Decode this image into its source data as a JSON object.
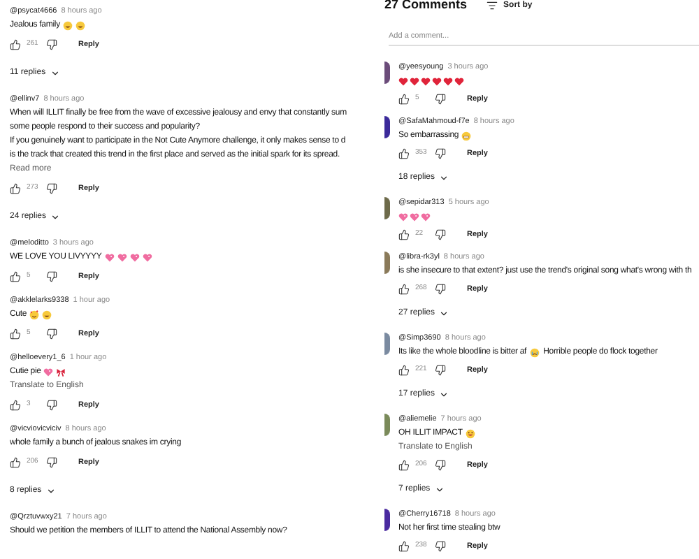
{
  "left_panel": {
    "items": [
      {
        "kind": "comment",
        "author": "@psycat4666",
        "time": "8 hours ago",
        "lines": [
          "Jealous family"
        ],
        "emojis": [
          {
            "kind": "laughing"
          },
          {
            "kind": "laughing"
          }
        ],
        "likes": "261",
        "reply": "Reply"
      },
      {
        "kind": "replies",
        "label": "11 replies"
      },
      {
        "kind": "comment",
        "author": "@ellinv7",
        "time": "8 hours ago",
        "lines": [
          "When will ILLIT finally be free from the wave of excessive jealousy and envy that constantly sum",
          "some people respond to their success and popularity?",
          "If you genuinely want to participate in the Not Cute Anymore challenge, it only makes sense to d",
          "is the track that created this trend in the first place and served as the initial spark for its spread."
        ],
        "read_more": "Read more",
        "likes": "273",
        "reply": "Reply"
      },
      {
        "kind": "replies",
        "label": "24 replies"
      },
      {
        "kind": "comment",
        "author": "@meloditto",
        "time": "3 hours ago",
        "lines": [
          "WE LOVE YOU LIVYYYY"
        ],
        "emojis": [
          {
            "kind": "pink-heart"
          },
          {
            "kind": "pink-heart"
          },
          {
            "kind": "pink-heart"
          },
          {
            "kind": "pink-heart"
          }
        ],
        "likes": "5",
        "reply": "Reply"
      },
      {
        "kind": "comment",
        "author": "@akklelarks9338",
        "time": "1 hour ago",
        "lines": [
          "Cute"
        ],
        "emojis": [
          {
            "kind": "heart-face"
          },
          {
            "kind": "laughing"
          }
        ],
        "likes": "5",
        "reply": "Reply"
      },
      {
        "kind": "comment",
        "author": "@helloevery1_6",
        "time": "1 hour ago",
        "lines": [
          "Cutie pie"
        ],
        "emojis": [
          {
            "kind": "pink-heart"
          },
          {
            "kind": "ribbon"
          }
        ],
        "translate": "Translate to English",
        "likes": "3",
        "reply": "Reply"
      },
      {
        "kind": "comment",
        "author": "@vicviovicviciv",
        "time": "8 hours ago",
        "lines": [
          "whole family a bunch of jealous snakes im crying"
        ],
        "likes": "206",
        "reply": "Reply"
      },
      {
        "kind": "replies",
        "label": "8 replies"
      },
      {
        "kind": "comment",
        "author": "@Qrztuvwxy21",
        "time": "7 hours ago",
        "lines": [
          "Should we petition the members of ILLIT to attend the National Assembly now?"
        ]
      }
    ]
  },
  "right_panel": {
    "title": "27 Comments",
    "sort": "Sort by",
    "add_comment": {
      "placeholder": "Add a comment..."
    },
    "items": [
      {
        "kind": "comment",
        "color": "#6b4c7a",
        "author": "@yeesyoung",
        "time": "3 hours ago",
        "emojis": [
          {
            "kind": "heart"
          },
          {
            "kind": "heart"
          },
          {
            "kind": "heart"
          },
          {
            "kind": "heart"
          },
          {
            "kind": "heart"
          },
          {
            "kind": "heart"
          }
        ],
        "likes": "5",
        "reply": "Reply"
      },
      {
        "kind": "comment",
        "color": "#3b2a9a",
        "author": "@SafaMahmoud-f7e",
        "time": "8 hours ago",
        "lines": [
          "So embarrassing"
        ],
        "emojis": [
          {
            "kind": "grimace"
          }
        ],
        "likes": "353",
        "reply": "Reply"
      },
      {
        "kind": "replies",
        "label": "18 replies"
      },
      {
        "kind": "comment",
        "color": "#6d6a4a",
        "author": "@sepidar313",
        "time": "5 hours ago",
        "emojis": [
          {
            "kind": "pink-heart"
          },
          {
            "kind": "pink-heart"
          },
          {
            "kind": "pink-heart"
          }
        ],
        "likes": "22",
        "reply": "Reply"
      },
      {
        "kind": "comment",
        "color": "#8a7a5a",
        "author": "@libra-rk3yl",
        "time": "8 hours ago",
        "lines": [
          "is she insecure to that extent? just use the trend's original song what's wrong with th"
        ],
        "likes": "268",
        "reply": "Reply"
      },
      {
        "kind": "replies",
        "label": "27 replies"
      },
      {
        "kind": "comment",
        "color": "#7a8aa0",
        "author": "@Simp3690",
        "time": "8 hours ago",
        "lines": [
          "Its like the whole bloodline is bitter af"
        ],
        "emojis": [
          {
            "kind": "crying"
          }
        ],
        "after": "Horrible people do flock together",
        "likes": "221",
        "reply": "Reply"
      },
      {
        "kind": "replies",
        "label": "17 replies"
      },
      {
        "kind": "comment",
        "color": "#7a8a5a",
        "author": "@aliemelie",
        "time": "7 hours ago",
        "lines": [
          "OH ILLIT IMPACT"
        ],
        "emojis": [
          {
            "kind": "angry"
          }
        ],
        "translate": "Translate to English",
        "likes": "206",
        "reply": "Reply"
      },
      {
        "kind": "replies",
        "label": "7 replies"
      },
      {
        "kind": "comment",
        "color": "#4a2aa0",
        "author": "@Cherry16718",
        "time": "8 hours ago",
        "lines": [
          "Not her first time stealing btw"
        ],
        "likes": "238",
        "reply": "Reply"
      }
    ]
  }
}
